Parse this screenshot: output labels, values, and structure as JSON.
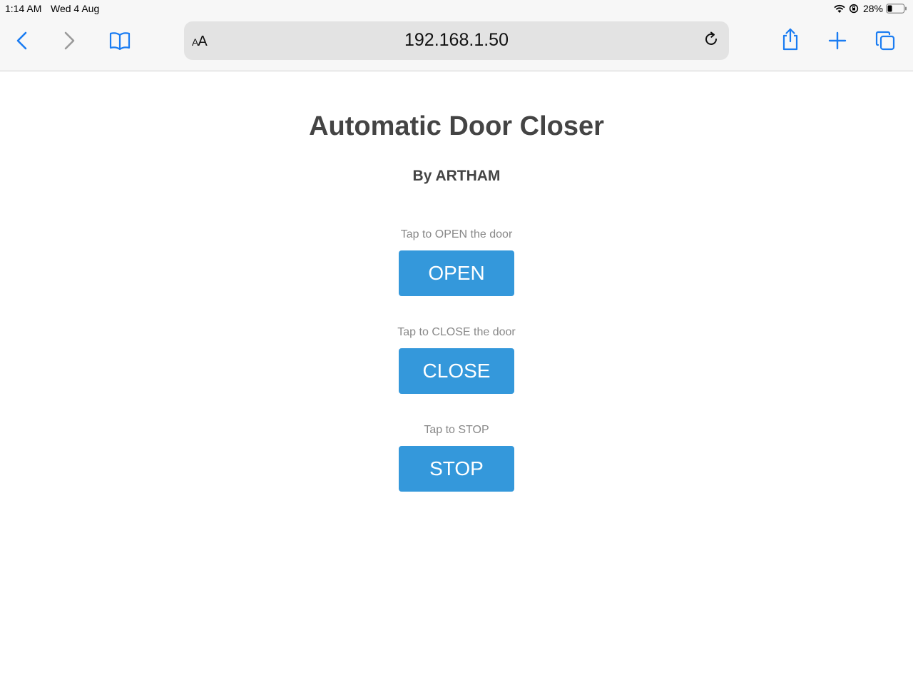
{
  "status_bar": {
    "time": "1:14 AM",
    "date": "Wed 4 Aug",
    "battery_percent": "28%",
    "battery_level": 0.28
  },
  "toolbar": {
    "address": "192.168.1.50",
    "text_size_label_small": "A",
    "text_size_label_large": "A",
    "accent_color": "#1a7cf2",
    "icons": [
      "back-icon",
      "forward-icon",
      "book-icon",
      "reload-icon",
      "share-icon",
      "plus-icon",
      "tabs-icon"
    ]
  },
  "page": {
    "title": "Automatic Door Closer",
    "subtitle": "By ARTHAM",
    "controls": [
      {
        "hint": "Tap to OPEN the door",
        "button": "OPEN"
      },
      {
        "hint": "Tap to CLOSE the door",
        "button": "CLOSE"
      },
      {
        "hint": "Tap to STOP",
        "button": "STOP"
      }
    ],
    "button_color": "#3498db"
  }
}
